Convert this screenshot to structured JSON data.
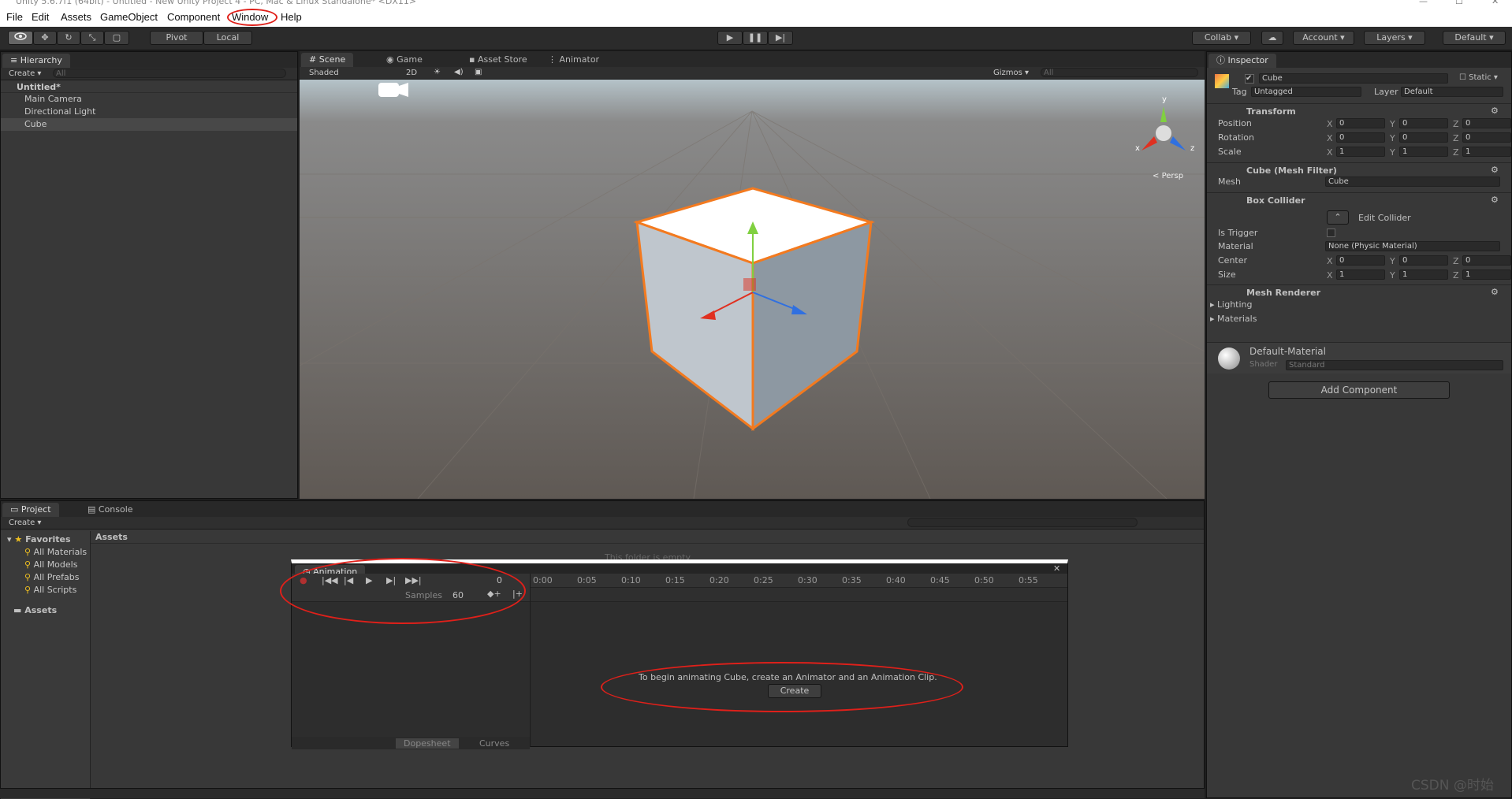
{
  "window": {
    "title": "Unity 5.6.7f1 (64bit) - Untitled - New Unity Project 4 - PC, Mac & Linux Standalone* <DX11>",
    "controls": [
      "—",
      "☐",
      "✕"
    ]
  },
  "menu": [
    "File",
    "Edit",
    "Assets",
    "GameObject",
    "Component",
    "Window",
    "Help"
  ],
  "toolbar": {
    "pivot": "Pivot",
    "local": "Local",
    "collab": "Collab",
    "account": "Account",
    "layers": "Layers",
    "layout": "Default"
  },
  "hierarchy": {
    "tab": "Hierarchy",
    "create": "Create",
    "search": "All",
    "scene": "Untitled*",
    "items": [
      "Main Camera",
      "Directional Light",
      "Cube"
    ],
    "selected": 2
  },
  "scene": {
    "tabs": [
      "Scene",
      "Game",
      "Asset Store",
      "Animator"
    ],
    "shading": "Shaded",
    "mode2d": "2D",
    "gizmos": "Gizmos",
    "search": "All",
    "persp": "Persp",
    "axes": {
      "x": "x",
      "y": "y",
      "z": "z"
    }
  },
  "inspector": {
    "tab": "Inspector",
    "object": "Cube",
    "static": "Static",
    "tag_label": "Tag",
    "tag": "Untagged",
    "layer_label": "Layer",
    "layer": "Default",
    "transform": {
      "title": "Transform",
      "rows": [
        {
          "label": "Position",
          "x": "0",
          "y": "0",
          "z": "0"
        },
        {
          "label": "Rotation",
          "x": "0",
          "y": "0",
          "z": "0"
        },
        {
          "label": "Scale",
          "x": "1",
          "y": "1",
          "z": "1"
        }
      ]
    },
    "mesh_filter": {
      "title": "Cube (Mesh Filter)",
      "mesh_label": "Mesh",
      "mesh": "Cube"
    },
    "box_collider": {
      "title": "Box Collider",
      "edit": "Edit Collider",
      "trigger": "Is Trigger",
      "material_label": "Material",
      "material": "None (Physic Material)",
      "center_label": "Center",
      "center": {
        "x": "0",
        "y": "0",
        "z": "0"
      },
      "size_label": "Size",
      "size": {
        "x": "1",
        "y": "1",
        "z": "1"
      }
    },
    "mesh_renderer": {
      "title": "Mesh Renderer",
      "lighting": "Lighting",
      "materials": "Materials"
    },
    "material": {
      "name": "Default-Material",
      "shader_label": "Shader",
      "shader": "Standard"
    },
    "add_component": "Add Component"
  },
  "project": {
    "tabs": [
      "Project",
      "Console"
    ],
    "create": "Create",
    "favorites": "Favorites",
    "fav_items": [
      "All Materials",
      "All Models",
      "All Prefabs",
      "All Scripts"
    ],
    "assets": "Assets",
    "assets_header": "Assets",
    "empty": "This folder is empty"
  },
  "animation": {
    "tab": "Animation",
    "frame": "0",
    "samples_label": "Samples",
    "samples": "60",
    "ticks": [
      "0:00",
      "0:05",
      "0:10",
      "0:15",
      "0:20",
      "0:25",
      "0:30",
      "0:35",
      "0:40",
      "0:45",
      "0:50",
      "0:55"
    ],
    "message": "To begin animating Cube, create an Animator and an Animation Clip.",
    "create": "Create",
    "dopesheet": "Dopesheet",
    "curves": "Curves"
  },
  "watermark": "CSDN @时始",
  "colors": {
    "accent": "#e0201a",
    "selection": "#f37a1f",
    "panel": "#383838"
  }
}
